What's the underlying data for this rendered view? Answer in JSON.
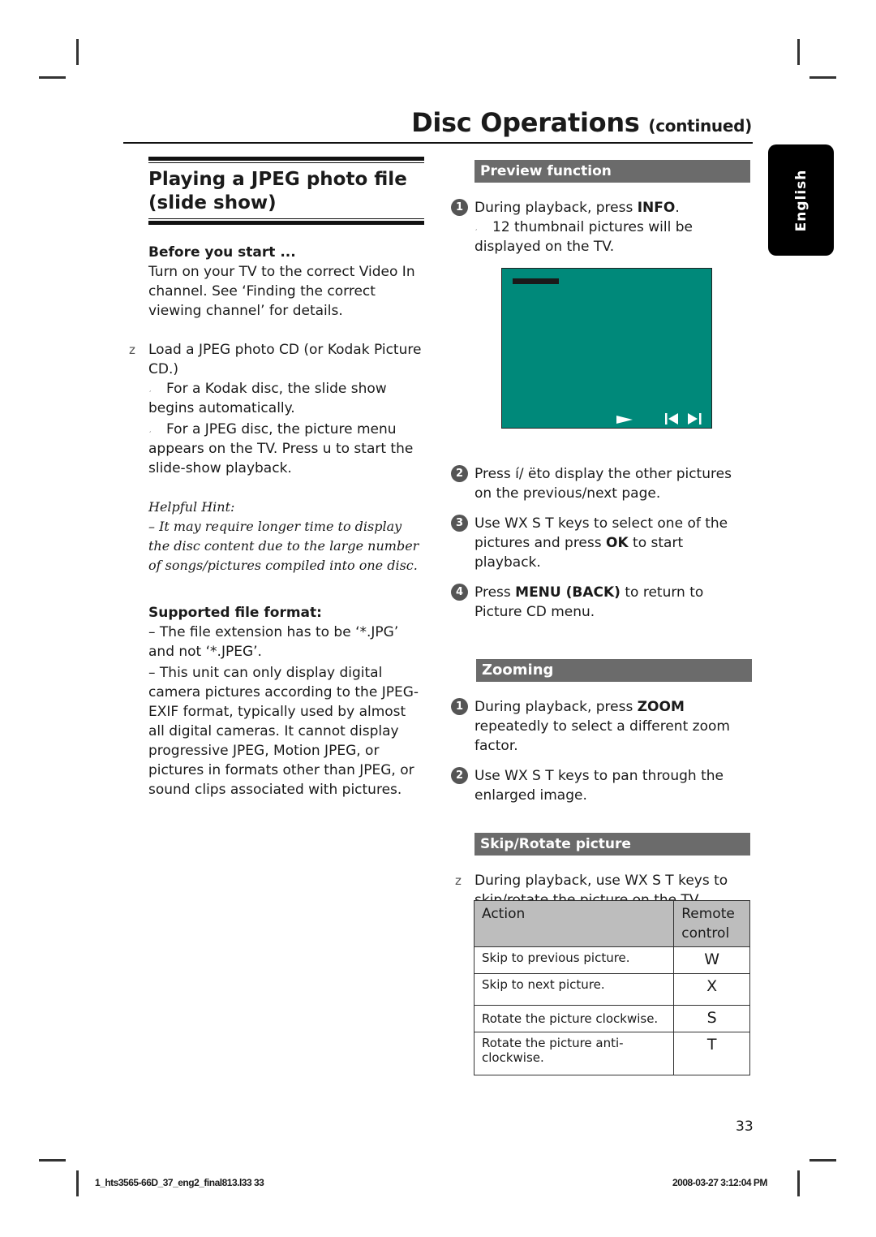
{
  "header": {
    "title": "Disc Operations",
    "title_suffix": "(continued)",
    "language_tab": "English"
  },
  "left": {
    "section_title_line1": "Playing a JPEG photo file",
    "section_title_line2": "(slide show)",
    "before_heading": "Before you start ...",
    "before_text": "Turn on your TV to the correct Video In channel.  See ‘Finding the correct viewing channel’ for details.",
    "load_bullet": "z",
    "load_text": "Load a JPEG photo CD (or Kodak Picture CD.)",
    "arrow_mark": "¸",
    "kodak_text": "For a Kodak disc, the slide show begins automatically.",
    "jpeg_text": "For a JPEG disc, the picture menu appears on the TV.  Press u to start the slide-show playback.",
    "hint_heading": "Helpful Hint:",
    "hint_text": "– It may require longer time to display the disc content due to the large number of songs/pictures compiled into one disc.",
    "format_heading": "Supported file format:",
    "format_item1": "–  The file extension has to be ‘*.JPG’ and not ‘*.JPEG’.",
    "format_item2": "– This unit can only display digital camera pictures according to the JPEG-EXIF format, typically used by almost all digital cameras.  It cannot display progressive JPEG, Motion JPEG, or pictures in formats other than JPEG, or sound clips associated with pictures."
  },
  "preview": {
    "heading": "Preview function",
    "step1_num": "1",
    "step1_pre": "During playback, press ",
    "step1_key": "INFO",
    "step1_post": ".",
    "step1_result": "12 thumbnail pictures will be displayed on the TV.",
    "tv_icons": {
      "play": "►",
      "prev": "I◄",
      "next": "►I"
    },
    "step2_num": "2",
    "step2_text": "Press í/ ëto display the other pictures on the previous/next page.",
    "step3_num": "3",
    "step3_pre": "Use  WX S T keys to select one of the pictures and press ",
    "step3_key": "OK",
    "step3_post": " to start playback.",
    "step4_num": "4",
    "step4_pre": "Press ",
    "step4_key": "MENU (BACK)",
    "step4_post": " to return to Picture CD menu."
  },
  "zooming": {
    "heading": "Zooming",
    "step1_num": "1",
    "step1_pre": "During playback, press ",
    "step1_key": "ZOOM",
    "step1_post": " repeatedly to select a different zoom factor.",
    "step2_num": "2",
    "step2_text": "Use  WX S T keys to pan through the enlarged image."
  },
  "skip": {
    "heading": "Skip/Rotate picture",
    "bullet": "z",
    "text": "During playback, use  WX S T keys to skip/rotate the picture on the TV.",
    "table": {
      "headers": [
        "Action",
        "Remote control"
      ],
      "rows": [
        {
          "action": "Skip to previous picture.",
          "key": "W"
        },
        {
          "action": "Skip to next picture.",
          "key": "X"
        },
        {
          "action": "Rotate the picture clockwise.",
          "key": "S"
        },
        {
          "action": "Rotate the picture anti-clockwise.",
          "key": "T"
        }
      ]
    }
  },
  "page_number": "33",
  "footer": {
    "file": "1_hts3565-66D_37_eng2_final813.l33   33",
    "timestamp": "2008-03-27   3:12:04 PM"
  },
  "colors": {
    "section_bar": "#6b6b6b",
    "tv_screen": "#00897a",
    "table_header": "#bdbdbd"
  }
}
